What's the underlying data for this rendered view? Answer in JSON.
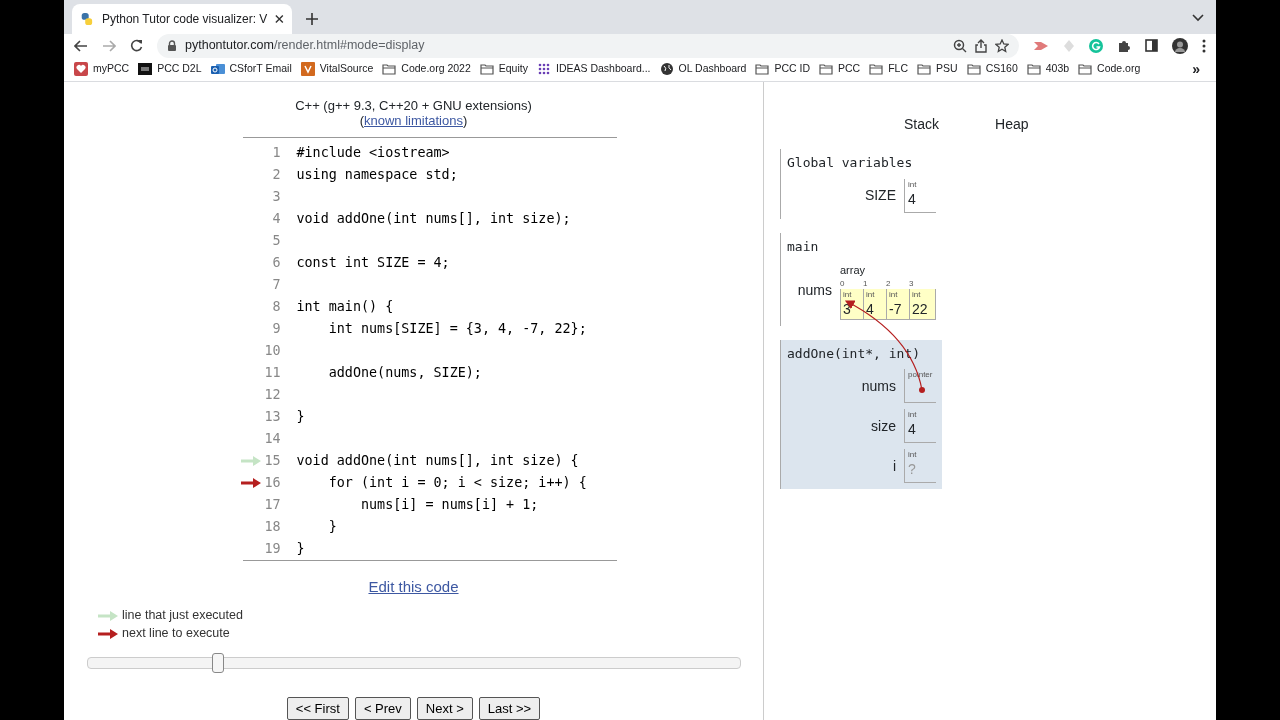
{
  "browser": {
    "tab_title": "Python Tutor code visualizer: V",
    "url_host": "pythontutor.com",
    "url_path": "/render.html#mode=display",
    "bookmarks": [
      {
        "label": "myPCC",
        "kind": "heart"
      },
      {
        "label": "PCC D2L",
        "kind": "dark"
      },
      {
        "label": "CSforT Email",
        "kind": "mail"
      },
      {
        "label": "VitalSource",
        "kind": "orange"
      },
      {
        "label": "Code.org 2022",
        "kind": "folder"
      },
      {
        "label": "Equity",
        "kind": "folder"
      },
      {
        "label": "IDEAS Dashboard...",
        "kind": "grid"
      },
      {
        "label": "OL Dashboard",
        "kind": "globe"
      },
      {
        "label": "PCC ID",
        "kind": "folder"
      },
      {
        "label": "PCC",
        "kind": "folder"
      },
      {
        "label": "FLC",
        "kind": "folder"
      },
      {
        "label": "PSU",
        "kind": "folder"
      },
      {
        "label": "CS160",
        "kind": "folder"
      },
      {
        "label": "403b",
        "kind": "folder"
      },
      {
        "label": "Code.org",
        "kind": "folder"
      }
    ],
    "more": "»"
  },
  "language": "C++ (g++ 9.3, C++20 + GNU extensions)",
  "limitations": {
    "open": "(",
    "link": "known limitations",
    "close": ")"
  },
  "code_lines": [
    {
      "number": "1",
      "text": "#include <iostream>"
    },
    {
      "number": "2",
      "text": "using namespace std;"
    },
    {
      "number": "3"
    },
    {
      "number": "4",
      "text": "void addOne(int nums[], int size);"
    },
    {
      "number": "5"
    },
    {
      "number": "6",
      "text": "const int SIZE = 4;"
    },
    {
      "number": "7"
    },
    {
      "number": "8",
      "text": "int main() {"
    },
    {
      "number": "9",
      "text": "    int nums[SIZE] = {3, 4, -7, 22};"
    },
    {
      "number": "10"
    },
    {
      "number": "11",
      "text": "    addOne(nums, SIZE);"
    },
    {
      "number": "12"
    },
    {
      "number": "13",
      "text": "}"
    },
    {
      "number": "14"
    },
    {
      "number": "15",
      "text": "void addOne(int nums[], int size) {",
      "kind": "executed"
    },
    {
      "number": "16",
      "text": "    for (int i = 0; i < size; i++) {",
      "kind": "next"
    },
    {
      "number": "17",
      "text": "        nums[i] = nums[i] + 1;"
    },
    {
      "number": "18",
      "text": "    }"
    },
    {
      "number": "19",
      "text": "}"
    }
  ],
  "edit_link": "Edit this code",
  "legend": [
    {
      "kind": "executed",
      "label": "line that just executed"
    },
    {
      "kind": "next",
      "label": "next line to execute"
    }
  ],
  "slider": {
    "level": 0.2
  },
  "nav_buttons": [
    "<< First",
    "< Prev",
    "Next >",
    "Last >>"
  ],
  "headings": [
    "Stack",
    "Heap"
  ],
  "frames": [
    {
      "title": "Global variables",
      "active": false,
      "vars": [
        {
          "name": "SIZE",
          "kind": "value",
          "type": "int",
          "value": "4"
        }
      ]
    },
    {
      "title": "main",
      "active": false,
      "vars": [
        {
          "name": "nums",
          "kind": "array",
          "label": "array",
          "elements": [
            {
              "index": "0",
              "type": "int",
              "value": "3"
            },
            {
              "index": "1",
              "type": "int",
              "value": "4"
            },
            {
              "index": "2",
              "type": "int",
              "value": "-7"
            },
            {
              "index": "3",
              "type": "int",
              "value": "22"
            }
          ]
        }
      ]
    },
    {
      "title": "addOne(int*, int)",
      "active": true,
      "vars": [
        {
          "name": "nums",
          "kind": "pointer",
          "type": "pointer"
        },
        {
          "name": "size",
          "kind": "value",
          "type": "int",
          "value": "4"
        },
        {
          "name": "i",
          "kind": "uninit",
          "type": "int",
          "value": "?"
        }
      ]
    }
  ]
}
